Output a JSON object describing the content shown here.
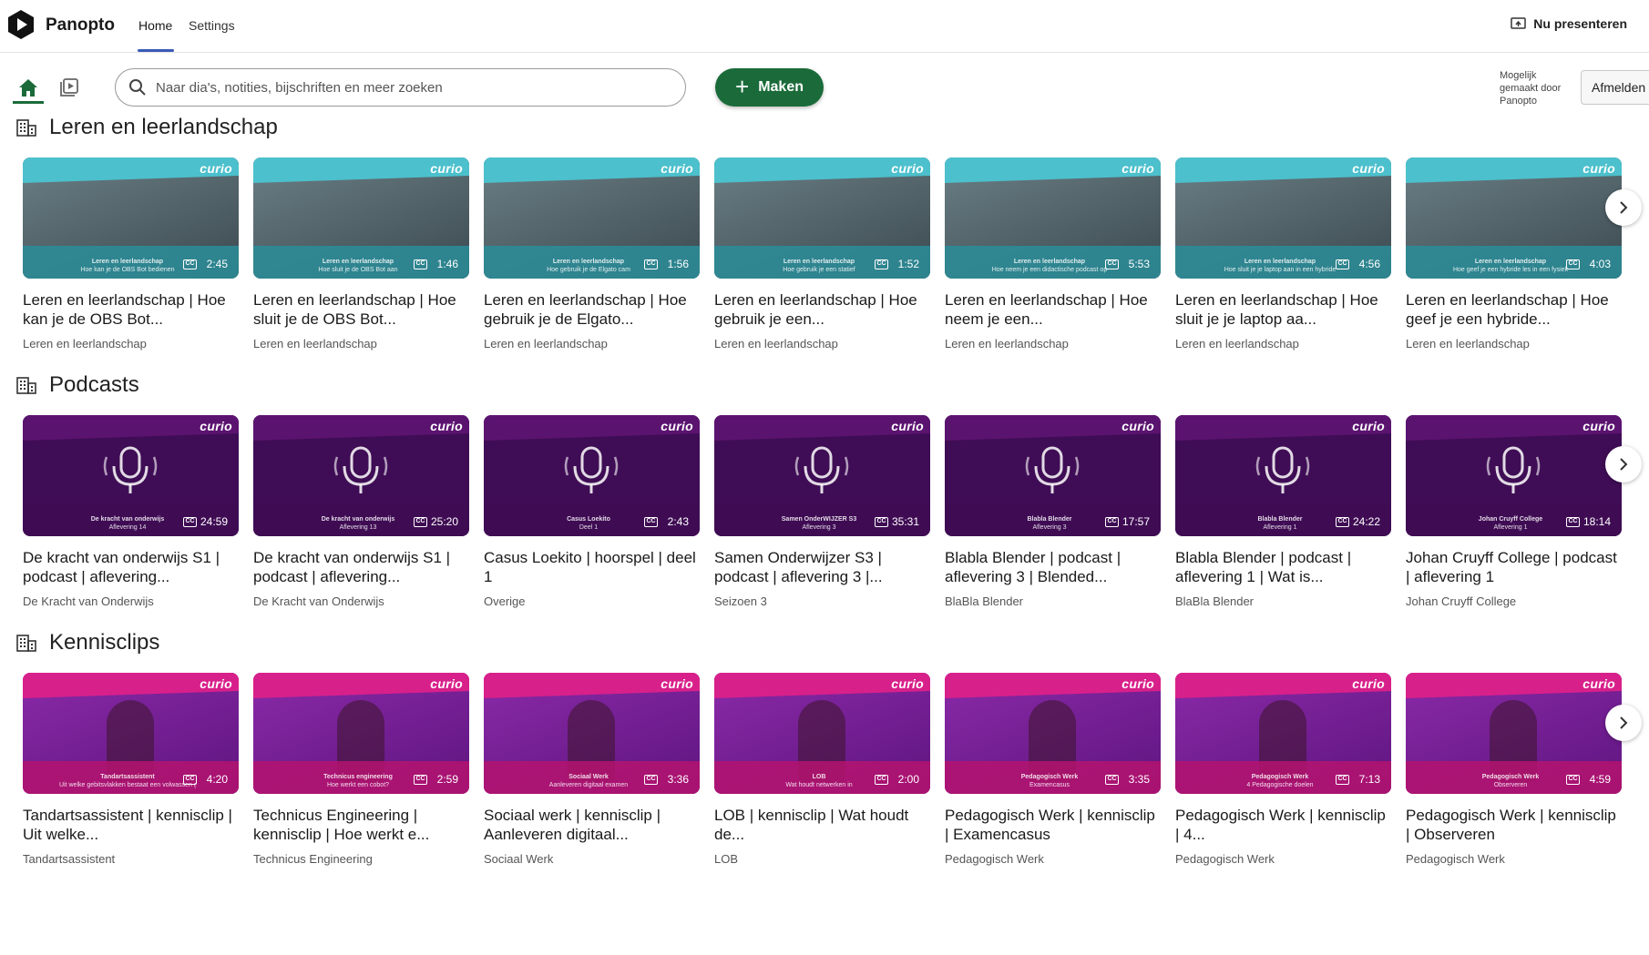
{
  "header": {
    "brand": "Panopto",
    "tabs": [
      {
        "label": "Home"
      },
      {
        "label": "Settings"
      }
    ],
    "present_label": "Nu presenteren"
  },
  "toolbar": {
    "search_placeholder": "Naar dia's, notities, bijschriften en meer zoeken",
    "make_label": "Maken",
    "powered_by": "Mogelijk gemaakt door Panopto",
    "logout_label": "Afmelden"
  },
  "colors": {
    "accent_green": "#1b6b3a",
    "thumb_teal": "#3aa7b4",
    "thumb_purple": "#5b1370",
    "thumb_magenta": "#d8208a"
  },
  "sections": [
    {
      "title": "Leren en leerlandschap",
      "theme": "teal",
      "items": [
        {
          "title": "Leren en leerlandschap | Hoe kan je de OBS Bot...",
          "folder": "Leren en leerlandschap",
          "duration": "2:45",
          "thumb_text": "Leren en leerlandschap",
          "thumb_text2": "Hoe kan je de OBS Bot bedienen"
        },
        {
          "title": "Leren en leerlandschap | Hoe sluit je de OBS Bot...",
          "folder": "Leren en leerlandschap",
          "duration": "1:46",
          "thumb_text": "Leren en leerlandschap",
          "thumb_text2": "Hoe sluit je de OBS Bot aan"
        },
        {
          "title": "Leren en leerlandschap | Hoe gebruik je de Elgato...",
          "folder": "Leren en leerlandschap",
          "duration": "1:56",
          "thumb_text": "Leren en leerlandschap",
          "thumb_text2": "Hoe gebruik je de Elgato cam"
        },
        {
          "title": "Leren en leerlandschap | Hoe gebruik je een...",
          "folder": "Leren en leerlandschap",
          "duration": "1:52",
          "thumb_text": "Leren en leerlandschap",
          "thumb_text2": "Hoe gebruik je een statief"
        },
        {
          "title": "Leren en leerlandschap | Hoe neem je een...",
          "folder": "Leren en leerlandschap",
          "duration": "5:53",
          "thumb_text": "Leren en leerlandschap",
          "thumb_text2": "Hoe neem je een didactische podcast op"
        },
        {
          "title": "Leren en leerlandschap | Hoe sluit je je laptop aa...",
          "folder": "Leren en leerlandschap",
          "duration": "4:56",
          "thumb_text": "Leren en leerlandschap",
          "thumb_text2": "Hoe sluit je je laptop aan in een hybride"
        },
        {
          "title": "Leren en leerlandschap | Hoe geef je een hybride...",
          "folder": "Leren en leerlandschap",
          "duration": "4:03",
          "thumb_text": "Leren en leerlandschap",
          "thumb_text2": "Hoe geef je een hybride les in een fysiek"
        }
      ]
    },
    {
      "title": "Podcasts",
      "theme": "purple",
      "items": [
        {
          "title": "De kracht van onderwijs S1 | podcast | aflevering...",
          "folder": "De Kracht van Onderwijs",
          "duration": "24:59",
          "thumb_text": "De kracht van onderwijs",
          "thumb_text2": "Aflevering 14"
        },
        {
          "title": "De kracht van onderwijs S1 | podcast | aflevering...",
          "folder": "De Kracht van Onderwijs",
          "duration": "25:20",
          "thumb_text": "De kracht van onderwijs",
          "thumb_text2": "Aflevering 13"
        },
        {
          "title": "Casus Loekito | hoorspel | deel 1",
          "folder": "Overige",
          "duration": "2:43",
          "thumb_text": "Casus Loekito",
          "thumb_text2": "Deel 1"
        },
        {
          "title": "Samen Onderwijzer S3 | podcast | aflevering 3 |...",
          "folder": "Seizoen 3",
          "duration": "35:31",
          "thumb_text": "Samen OnderWIJZER S3",
          "thumb_text2": "Aflevering 3"
        },
        {
          "title": "Blabla Blender | podcast | aflevering 3 | Blended...",
          "folder": "BlaBla Blender",
          "duration": "17:57",
          "thumb_text": "Blabla Blender",
          "thumb_text2": "Aflevering 3"
        },
        {
          "title": "Blabla Blender | podcast | aflevering 1 | Wat is...",
          "folder": "BlaBla Blender",
          "duration": "24:22",
          "thumb_text": "Blabla Blender",
          "thumb_text2": "Aflevering 1"
        },
        {
          "title": "Johan Cruyff College | podcast | aflevering 1",
          "folder": "Johan Cruyff College",
          "duration": "18:14",
          "thumb_text": "Johan Cruyff College",
          "thumb_text2": "Aflevering 1"
        }
      ]
    },
    {
      "title": "Kennisclips",
      "theme": "magenta",
      "items": [
        {
          "title": "Tandartsassistent | kennisclip | Uit welke...",
          "folder": "Tandartsassistent",
          "duration": "4:20",
          "thumb_text": "Tandartsassistent",
          "thumb_text2": "Uit welke gebitsvlakken bestaat een volwassen gebit"
        },
        {
          "title": "Technicus Engineering | kennisclip | Hoe werkt e...",
          "folder": "Technicus Engineering",
          "duration": "2:59",
          "thumb_text": "Technicus engineering",
          "thumb_text2": "Hoe werkt een cobot?"
        },
        {
          "title": "Sociaal werk | kennisclip | Aanleveren digitaal...",
          "folder": "Sociaal Werk",
          "duration": "3:36",
          "thumb_text": "Sociaal Werk",
          "thumb_text2": "Aanleveren digitaal examen"
        },
        {
          "title": "LOB | kennisclip | Wat houdt de...",
          "folder": "LOB",
          "duration": "2:00",
          "thumb_text": "LOB",
          "thumb_text2": "Wat houdt netwerken in"
        },
        {
          "title": "Pedagogisch Werk | kennisclip | Examencasus",
          "folder": "Pedagogisch Werk",
          "duration": "3:35",
          "thumb_text": "Pedagogisch Werk",
          "thumb_text2": "Examencasus"
        },
        {
          "title": "Pedagogisch Werk | kennisclip | 4...",
          "folder": "Pedagogisch Werk",
          "duration": "7:13",
          "thumb_text": "Pedagogisch Werk",
          "thumb_text2": "4 Pedagogische doelen"
        },
        {
          "title": "Pedagogisch Werk | kennisclip | Observeren",
          "folder": "Pedagogisch Werk",
          "duration": "4:59",
          "thumb_text": "Pedagogisch Werk",
          "thumb_text2": "Observeren"
        }
      ]
    }
  ]
}
